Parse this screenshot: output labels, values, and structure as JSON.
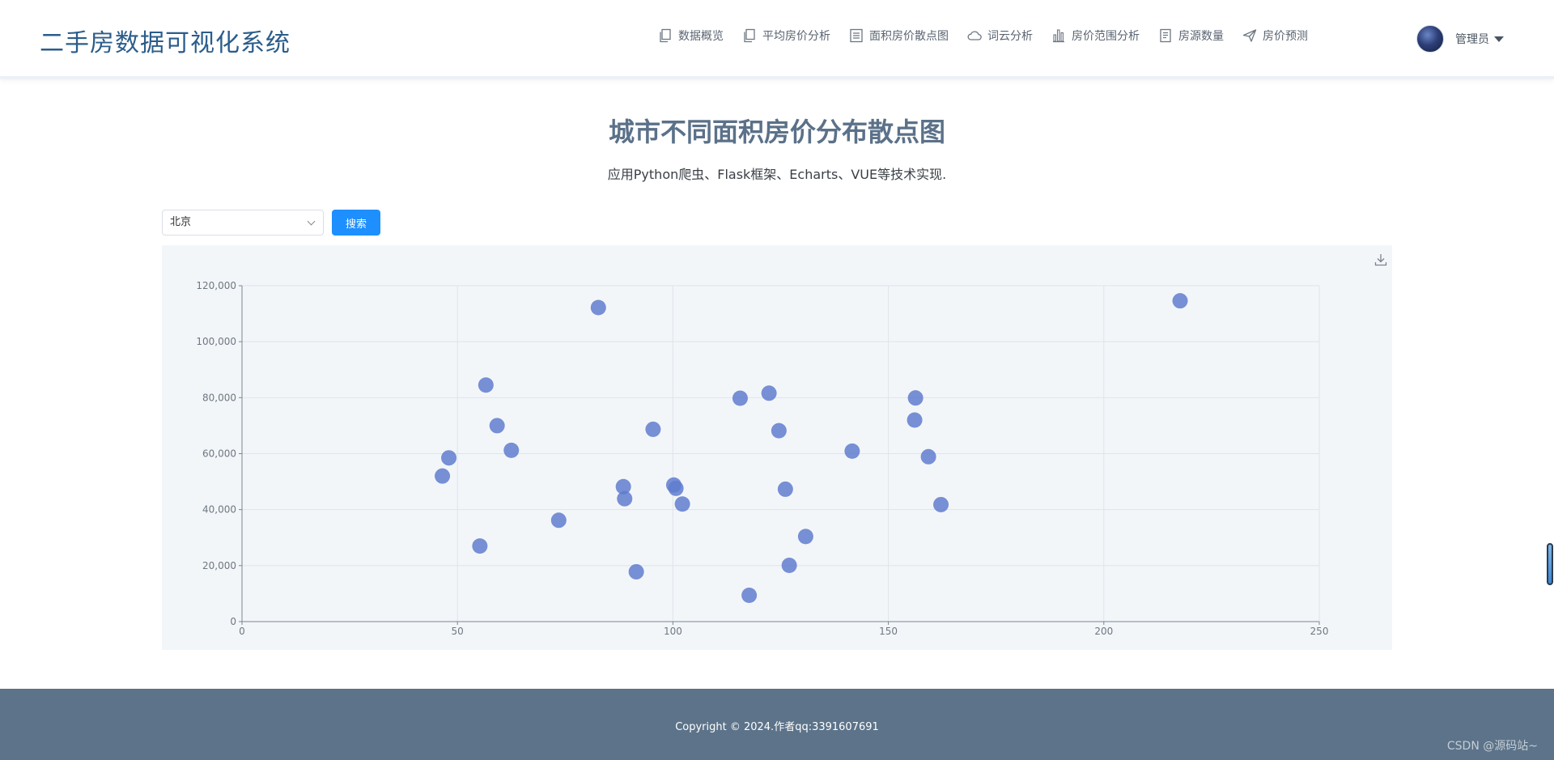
{
  "header": {
    "brand": "二手房数据可视化系统",
    "nav": [
      {
        "label": "数据概览",
        "icon": "copy-icon"
      },
      {
        "label": "平均房价分析",
        "icon": "copy-icon"
      },
      {
        "label": "面积房价散点图",
        "icon": "list-icon"
      },
      {
        "label": "词云分析",
        "icon": "cloud-icon"
      },
      {
        "label": "房价范围分析",
        "icon": "bar-chart-icon"
      },
      {
        "label": "房源数量",
        "icon": "document-icon"
      },
      {
        "label": "房价预测",
        "icon": "send-icon"
      }
    ],
    "user_name": "管理员"
  },
  "main": {
    "title": "城市不同面积房价分布散点图",
    "subtitle": "应用Python爬虫、Flask框架、Echarts、VUE等技术实现.",
    "city_value": "北京",
    "search_label": "搜索"
  },
  "chart_data": {
    "type": "scatter",
    "title": "",
    "xlabel": "",
    "ylabel": "",
    "xlim": [
      0,
      250
    ],
    "ylim": [
      0,
      120000
    ],
    "x_ticks": [
      "0",
      "50",
      "100",
      "150",
      "200",
      "250"
    ],
    "y_ticks": [
      "0",
      "20,000",
      "40,000",
      "60,000",
      "80,000",
      "100,000",
      "120,000"
    ],
    "grid": true,
    "color": "#5f7ccf",
    "points": [
      [
        46.5,
        52000
      ],
      [
        48,
        58500
      ],
      [
        55.2,
        27000
      ],
      [
        56.6,
        84500
      ],
      [
        59.2,
        70000
      ],
      [
        62.5,
        61200
      ],
      [
        73.5,
        36200
      ],
      [
        82.7,
        112200
      ],
      [
        88.5,
        48200
      ],
      [
        88.8,
        43900
      ],
      [
        91.5,
        17800
      ],
      [
        95.4,
        68700
      ],
      [
        100.2,
        48800
      ],
      [
        100.7,
        47600
      ],
      [
        102.2,
        42000
      ],
      [
        115.6,
        79800
      ],
      [
        117.7,
        9400
      ],
      [
        122.3,
        81600
      ],
      [
        124.6,
        68200
      ],
      [
        126.1,
        47300
      ],
      [
        127,
        20100
      ],
      [
        130.8,
        30400
      ],
      [
        141.6,
        60900
      ],
      [
        156.1,
        72000
      ],
      [
        156.3,
        79900
      ],
      [
        159.3,
        58900
      ],
      [
        162.2,
        41800
      ],
      [
        217.7,
        114600
      ]
    ]
  },
  "footer": {
    "copyright": "Copyright © 2024.作者qq:3391607691",
    "watermark": "CSDN @源码站~"
  }
}
